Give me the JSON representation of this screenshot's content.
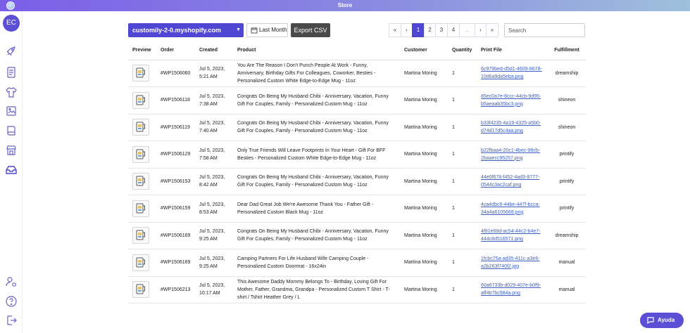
{
  "app": {
    "title": "Store"
  },
  "user": {
    "initials": "EC"
  },
  "sidebar": {
    "icons": [
      "rocket-icon",
      "document-list-icon",
      "tshirt-icon",
      "image-gallery-icon",
      "book-icon",
      "storefront-icon",
      "inbox-icon",
      "user-settings-icon",
      "help-icon",
      "logout-icon"
    ]
  },
  "toolbar": {
    "store": "customily-2-0.myshopify.com",
    "date_range": "Last Month",
    "export_label": "Export CSV",
    "search_placeholder": "Search"
  },
  "pagination": {
    "first": "«",
    "prev": "‹",
    "pages": [
      "1",
      "2",
      "3",
      "4"
    ],
    "ellipsis": "...",
    "next": "›",
    "last": "»",
    "current": "1"
  },
  "table": {
    "columns": [
      "Preview",
      "Order",
      "Created",
      "Product",
      "Customer",
      "Quantity",
      "Print File",
      "Fulfillment"
    ],
    "rows": [
      {
        "order": "#WP1506060",
        "created": "Jul 5, 2023, 5:21 AM",
        "product": "You Are The Reason I Don't Punch People At Work - Funny, Anniversary, Birthday Gifts For Colleagues, Coworker, Besties - Personalized Custom White Edge-to-Edge Mug - 11oz",
        "customer": "Martina Moring",
        "quantity": "1",
        "file": "6c979bed-d5d1-4609-8678-10d6a9da5eba.png",
        "fulfillment": "dreamship"
      },
      {
        "order": "#WP1506118",
        "created": "Jul 5, 2023, 7:38 AM",
        "product": "Congrats On Being My Husband Chibi - Anniversary, Vacation, Funny Gift For Couples, Family - Personalized Custom Mug - 11oz",
        "customer": "Martina Moring",
        "quantity": "1",
        "file": "85ec0a7e-8ccc-44cb-9d95-b5aeaab35bc3.png",
        "fulfillment": "shineon"
      },
      {
        "order": "#WP1506119",
        "created": "Jul 5, 2023, 7:40 AM",
        "product": "Congrats On Being My Husband Chibi - Anniversary, Vacation, Funny Gift For Couples, Family - Personalized Custom Mug - 11oz",
        "customer": "Martina Moring",
        "quantity": "1",
        "file": "b33f4235-4a19-4325-a5b0-d74d17d5c4aa.png",
        "fulfillment": "shineon"
      },
      {
        "order": "#WP1506129",
        "created": "Jul 5, 2023, 7:58 AM",
        "product": "Only True Friends Will Leave Footprints In Your Heart - Gift For BFF Besties - Personalized Custom White Edge-to-Edge Mug - 11oz",
        "customer": "Martina Moring",
        "quantity": "1",
        "file": "b22fbaa4-20c1-4bec-98cb-2baaecc95257.png",
        "fulfillment": "printify"
      },
      {
        "order": "#WP1506153",
        "created": "Jul 5, 2023, 8:42 AM",
        "product": "Congrats On Being My Husband Chibi - Anniversary, Vacation, Funny Gift For Couples, Family - Personalized Custom Mug - 11oz",
        "customer": "Martina Moring",
        "quantity": "1",
        "file": "44e0f678-f452-4ad3-8777-0544c3ac2caf.png",
        "fulfillment": "printify"
      },
      {
        "order": "#WP1506159",
        "created": "Jul 5, 2023, 8:53 AM",
        "product": "Dear Dad Great Job We're Awesome Thank You - Father Gift - Personalized Custom Black Mug - 11oz",
        "customer": "Martina Moring",
        "quantity": "1",
        "file": "4ca4dbc6-44be-447f-bcca-34a4a6105668.png",
        "fulfillment": "printify"
      },
      {
        "order": "#WP1506169",
        "created": "Jul 5, 2023, 9:25 AM",
        "product": "Congrats On Being My Husband Chibi - Anniversary, Vacation, Funny Gift For Couples, Family - Personalized Custom Mug - 11oz",
        "customer": "Martina Moring",
        "quantity": "1",
        "file": "4f81e68d-ac54-44c2-b4e7-444c8d516571.png",
        "fulfillment": "dreamship"
      },
      {
        "order": "#WP1506169",
        "created": "Jul 5, 2023, 9:25 AM",
        "product": "Camping Partners For Life Husband Wife Camping Couple - Personalized Custom Doormat - 16x24in",
        "customer": "Martina Moring",
        "quantity": "1",
        "file": "1fcbc75a-ad35-411c-a3e6-a2b263f740f2.jpg",
        "fulfillment": "manual"
      },
      {
        "order": "#WP1506213",
        "created": "Jul 5, 2023, 10:17 AM",
        "product": "This Awesome Daddy Mommy Belongs To - Birthday, Loving Gift For Mother, Father, Grandma, Grandpa - Personalized Custom T Shirt - T-shirt / Tshirt Heather Grey / L",
        "customer": "Martina Moring",
        "quantity": "1",
        "file": "60a6733b-d029-407e-b0f9-aff4b7bc984a.png",
        "fulfillment": "manual"
      }
    ]
  },
  "help": {
    "label": "Ayuda"
  },
  "colors": {
    "accent": "#5046d4",
    "link": "#3d5fc4",
    "export": "#4a4a4a"
  }
}
